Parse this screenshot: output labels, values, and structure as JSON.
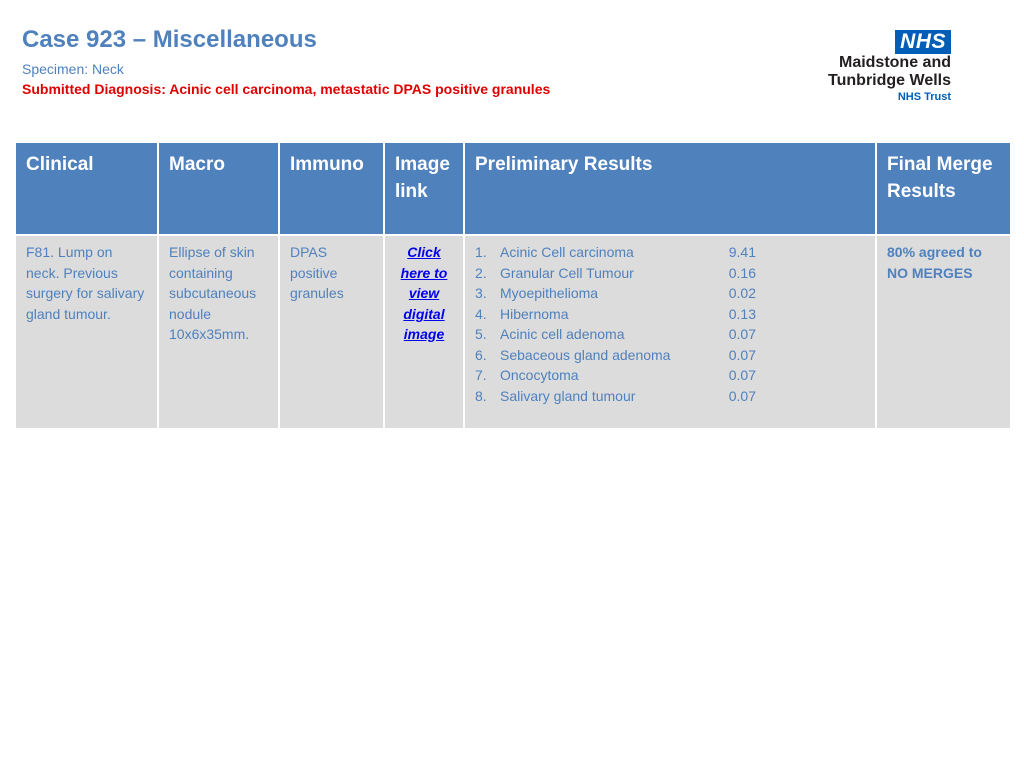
{
  "header": {
    "title": "Case 923 – Miscellaneous",
    "specimen": "Specimen: Neck",
    "diagnosis": "Submitted Diagnosis: Acinic cell carcinoma, metastatic DPAS positive granules"
  },
  "logo": {
    "badge": "NHS",
    "line1": "Maidstone and",
    "line2": "Tunbridge Wells",
    "line3": "NHS Trust"
  },
  "colors": {
    "header_blue": "#4f81bd",
    "alert_red": "#e00000",
    "cell_grey": "#dcdcdc",
    "nhs_blue": "#005eb8"
  },
  "table": {
    "headers": {
      "clinical": "Clinical",
      "macro": "Macro",
      "immuno": "Immuno",
      "image": "Image link",
      "prelim": "Preliminary Results",
      "final": "Final Merge Results"
    },
    "clinical": "F81. Lump on neck. Previous surgery for salivary gland tumour.",
    "macro": "Ellipse of skin containing subcutaneous nodule 10x6x35mm.",
    "immuno": "DPAS positive granules",
    "image_link": "Click here to view digital image",
    "prelim": [
      {
        "num": "1.",
        "name": "Acinic Cell carcinoma",
        "score": "9.41"
      },
      {
        "num": "2.",
        "name": "Granular Cell Tumour",
        "score": "0.16"
      },
      {
        "num": "3.",
        "name": "Myoepithelioma",
        "score": "0.02"
      },
      {
        "num": "4.",
        "name": "Hibernoma",
        "score": "0.13"
      },
      {
        "num": "5.",
        "name": "Acinic cell adenoma",
        "score": "0.07"
      },
      {
        "num": "6.",
        "name": "Sebaceous gland adenoma",
        "score": "0.07"
      },
      {
        "num": "7.",
        "name": "Oncocytoma",
        "score": "0.07"
      },
      {
        "num": "8.",
        "name": "Salivary gland tumour",
        "score": "0.07"
      }
    ],
    "final": "80% agreed to NO MERGES"
  }
}
